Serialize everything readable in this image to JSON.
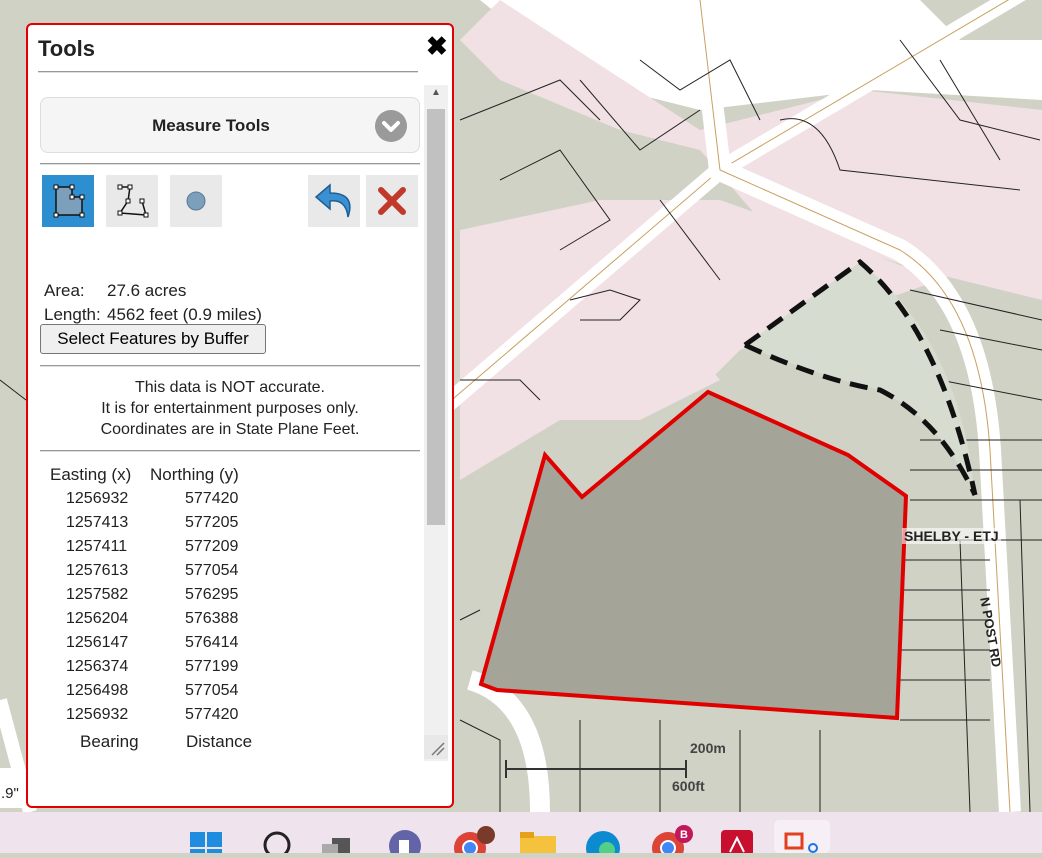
{
  "map": {
    "etj_label": "SHELBY - ETJ",
    "road_label": "N POST RD",
    "scale_m": "200m",
    "scale_ft": "600ft",
    "edge_fragment": ".9\""
  },
  "panel": {
    "title": "Tools",
    "close_icon": "close-icon",
    "dropdown_label": "Measure Tools",
    "tools": [
      "polygon-measure-icon",
      "polyline-measure-icon",
      "point-measure-icon",
      "undo-icon",
      "clear-icon"
    ],
    "area_label": "Area:",
    "area_value": "27.6 acres",
    "length_label": "Length:",
    "length_value": "4562 feet (0.9 miles)",
    "buffer_button": "Select Features by Buffer",
    "disclaimer": [
      "This data is NOT accurate.",
      "It is for entertainment purposes only.",
      "Coordinates are in State Plane Feet."
    ],
    "coord_headers": {
      "easting": "Easting (x)",
      "northing": "Northing (y)"
    },
    "coords": [
      {
        "x": "1256932",
        "y": "577420"
      },
      {
        "x": "1257413",
        "y": "577205"
      },
      {
        "x": "1257411",
        "y": "577209"
      },
      {
        "x": "1257613",
        "y": "577054"
      },
      {
        "x": "1257582",
        "y": "576295"
      },
      {
        "x": "1256204",
        "y": "576388"
      },
      {
        "x": "1256147",
        "y": "576414"
      },
      {
        "x": "1256374",
        "y": "577199"
      },
      {
        "x": "1256498",
        "y": "577054"
      },
      {
        "x": "1256932",
        "y": "577420"
      }
    ],
    "bearing_header": "Bearing",
    "distance_header": "Distance"
  },
  "colors": {
    "highlight": "#e00000",
    "selected_tool": "#2e8fd0",
    "parcel_pink": "#f1e1e5",
    "parcel_green": "#cfd2c4"
  },
  "taskbar": {
    "icons": [
      "windows-start-icon",
      "search-icon",
      "task-view-icon",
      "teams-icon",
      "chrome-profile-icon",
      "file-explorer-icon",
      "edge-icon",
      "chrome-icon",
      "acrobat-icon",
      "snipping-tool-icon"
    ]
  }
}
